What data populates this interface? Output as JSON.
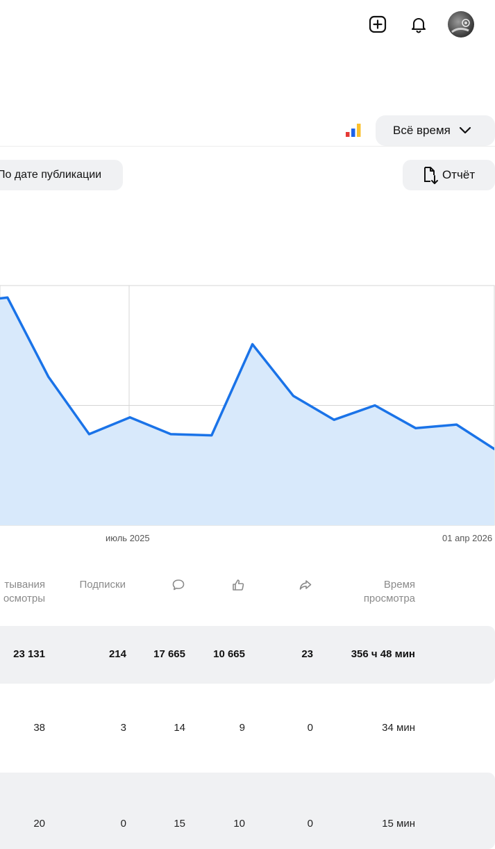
{
  "header": {
    "add_icon": "plus-square-icon",
    "bell_icon": "bell-icon",
    "avatar": "user-avatar"
  },
  "controls": {
    "period_label": "Всё время",
    "sort_label": "По дате публикации",
    "report_label": "Отчёт",
    "metrica_colors": [
      "#e53935",
      "#1e63e9",
      "#fbc02d"
    ]
  },
  "chart_data": {
    "type": "area",
    "x_labels": [
      "июль 2025",
      "01 апр 2026"
    ],
    "y_relative": [
      0.93,
      0.95,
      0.62,
      0.38,
      0.45,
      0.38,
      0.375,
      0.755,
      0.54,
      0.44,
      0.5,
      0.405,
      0.42,
      0.31
    ],
    "grid": true,
    "line_color": "#1a73e8",
    "fill_color": "#d8e9fb"
  },
  "table": {
    "headers": {
      "views_line1": "тывания",
      "views_line2": "осмотры",
      "subs": "Подписки",
      "comments_icon": "comment-icon",
      "likes_icon": "thumbs-up-icon",
      "shares_icon": "share-icon",
      "time_line1": "Время",
      "time_line2": "просмотра"
    },
    "rows": [
      {
        "views": "23 131",
        "subs": "214",
        "comments": "17 665",
        "likes": "10 665",
        "shares": "23",
        "time": "356 ч 48 мин"
      },
      {
        "views": "38",
        "subs": "3",
        "comments": "14",
        "likes": "9",
        "shares": "0",
        "time": "34 мин"
      },
      {
        "views": "20",
        "subs": "0",
        "comments": "15",
        "likes": "10",
        "shares": "0",
        "time": "15 мин"
      }
    ]
  }
}
